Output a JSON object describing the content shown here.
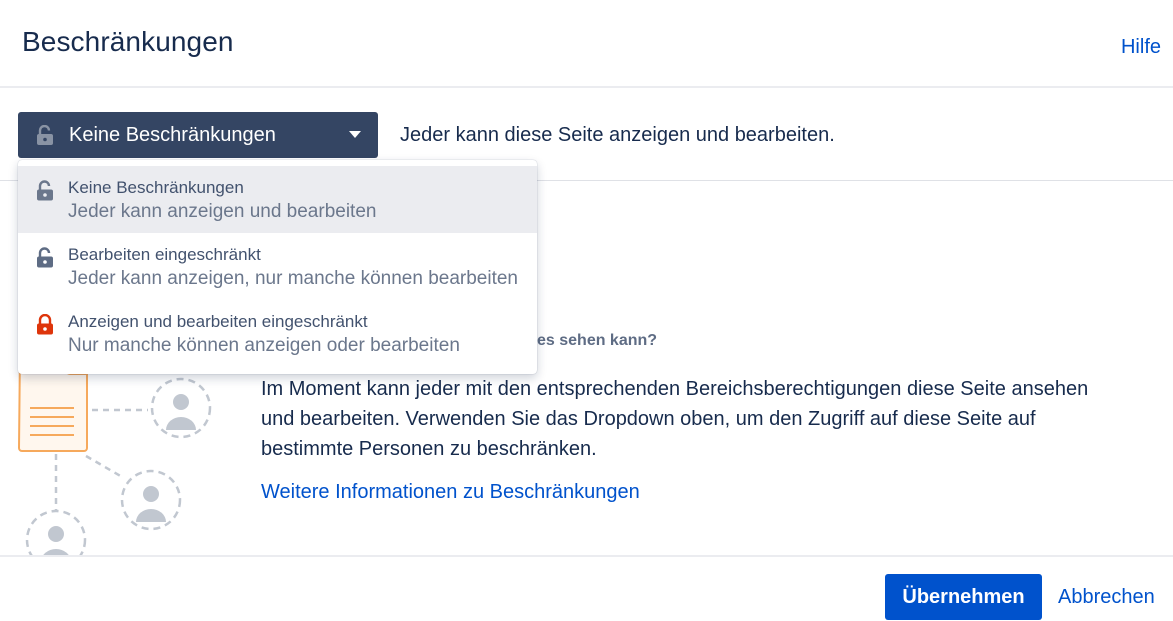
{
  "dialog": {
    "title": "Beschränkungen",
    "help_label": "Hilfe"
  },
  "restriction": {
    "selected_label": "Keine Beschränkungen",
    "selected_icon": "unlock-icon",
    "description": "Jeder kann diese Seite anzeigen und bearbeiten."
  },
  "menu": {
    "items": [
      {
        "title": "Keine Beschränkungen",
        "subtitle": "Jeder kann anzeigen und bearbeiten",
        "icon": "unlock-icon",
        "icon_color": "#6B778C",
        "active": true
      },
      {
        "title": "Bearbeiten eingeschränkt",
        "subtitle": "Jeder kann anzeigen, nur manche können bearbeiten",
        "icon": "unlock-icon",
        "icon_color": "#5E6C84",
        "active": false
      },
      {
        "title": "Anzeigen und bearbeiten eingeschränkt",
        "subtitle": "Nur manche können anzeigen oder bearbeiten",
        "icon": "lock-icon",
        "icon_color": "#DE350B",
        "active": false
      }
    ]
  },
  "content": {
    "question": "es sehen kann?",
    "body": "Im Moment kann jeder mit den entsprechenden Bereichsberechtigungen diese Seite ansehen und bearbeiten. Verwenden Sie das Dropdown oben, um den Zugriff auf diese Seite auf bestimmte Personen zu beschränken.",
    "more_link": "Weitere Informationen zu Beschränkungen"
  },
  "footer": {
    "apply_label": "Übernehmen",
    "cancel_label": "Abbrechen"
  },
  "colors": {
    "primary": "#0052CC",
    "select_bg": "#344563",
    "document_accent": "#F6A95C",
    "restricted": "#DE350B"
  }
}
